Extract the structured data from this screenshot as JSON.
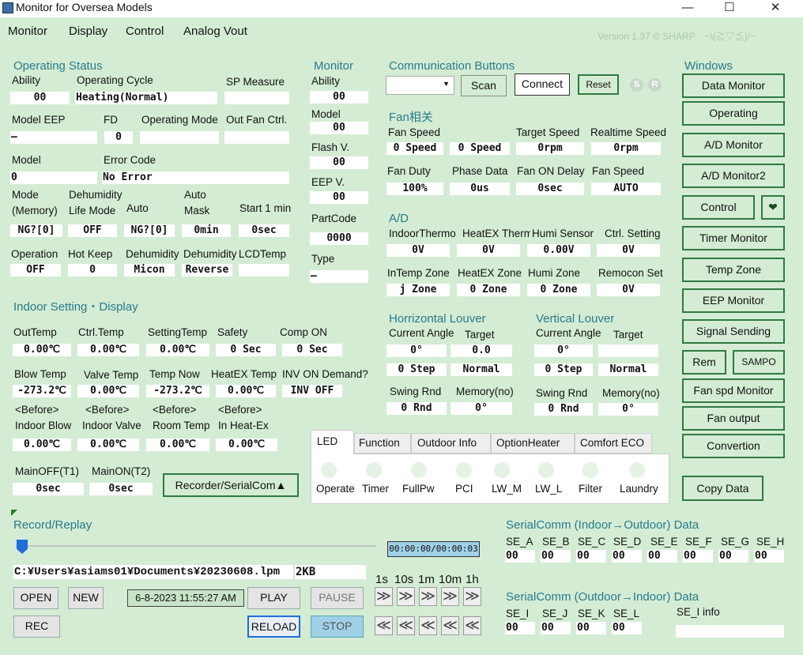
{
  "window": {
    "title": "Monitor for Oversea Models",
    "minimize": "—",
    "maximize": "☐",
    "close": "✕"
  },
  "menu": [
    "Monitor",
    "Display",
    "Control",
    "Analog Vout"
  ],
  "version": "Version 1.37 © SHARP　~\\(≧▽≦)/~",
  "op_status": {
    "title": "Operating Status",
    "ability_label": "Ability",
    "ability": "00",
    "cycle_label": "Operating Cycle",
    "cycle": "Heating(Normal)",
    "sp_label": "SP Measure",
    "sp": "",
    "eep_label": "Model EEP",
    "eep": "–",
    "fd_label": "FD",
    "fd": "0",
    "opmode_label": "Operating Mode",
    "opmode": "",
    "outfan_label": "Out Fan Ctrl.",
    "outfan": "",
    "model_label": "Model",
    "model": "0",
    "error_label": "Error Code",
    "error": "No Error",
    "mode_label1": "Mode",
    "mode_label2": "(Memory)",
    "mode": "NG?[0]",
    "dehum_label1": "Dehumidity",
    "dehum_label2": "Life Mode",
    "dehum": "OFF",
    "auto_label": "Auto",
    "auto": "NG?[0]",
    "automask_label1": "Auto",
    "automask_label2": "Mask",
    "automask": "0min",
    "start1_label": "Start 1 min",
    "start1": "0sec",
    "operation_label": "Operation",
    "operation": "OFF",
    "hotkeep_label": "Hot Keep",
    "hotkeep": "0",
    "dehum2_label": "Dehumidity",
    "dehum2": "Micon",
    "dehum3_label": "Dehumidity",
    "dehum3": "Reverse",
    "lcd_label": "LCDTemp",
    "lcd": ""
  },
  "monitor": {
    "title": "Monitor",
    "ability_label": "Ability",
    "ability": "00",
    "model_label": "Model",
    "model": "00",
    "flash_label": "Flash V.",
    "flash": "00",
    "eep_label": "EEP V.",
    "eep": "00",
    "partcode_label": "PartCode",
    "partcode": "0000",
    "type_label": "Type",
    "type": "–"
  },
  "comm": {
    "title": "Communication Buttons",
    "scan": "Scan",
    "connect": "Connect",
    "reset": "Reset",
    "s": "S",
    "r": "R"
  },
  "fan": {
    "title": "Fan相关",
    "speed_label": "Fan Speed",
    "speed1": "0 Speed",
    "speed2": "0 Speed",
    "target_label": "Target Speed",
    "target": "0rpm",
    "realtime_label": "Realtime Speed",
    "realtime": "0rpm",
    "duty_label": "Fan Duty",
    "duty": "100%",
    "phase_label": "Phase Data",
    "phase": "0us",
    "ondelay_label": "Fan ON Delay",
    "ondelay": "0sec",
    "fanspeed2_label": "Fan Speed",
    "fanspeed2": "AUTO"
  },
  "ad": {
    "title": "A/D",
    "indoor_label": "IndoorThermo",
    "indoor": "0V",
    "heatex_label": "HeatEX Thermo",
    "heatex": "0V",
    "humi_label": "Humi Sensor",
    "humi": "0.00V",
    "ctrl_label": "Ctrl. Setting",
    "ctrl": "0V",
    "intemp_label": "InTemp Zone",
    "intemp": "j Zone",
    "hexzone_label": "HeatEX Zone",
    "hexzone": "0 Zone",
    "humizone_label": "Humi Zone",
    "humizone": "0 Zone",
    "remocon_label": "Remocon Set",
    "remocon": "0V"
  },
  "hlouver": {
    "title": "Horrizontal Louver",
    "angle_label": "Current Angle",
    "angle": "0°",
    "target_label": "Target",
    "target": "0.0",
    "step": "0 Step",
    "mode": "Normal",
    "swing_label": "Swing Rnd",
    "swing": "0 Rnd",
    "mem_label": "Memory(no)",
    "mem": "0°"
  },
  "vlouver": {
    "title": "Vertical Louver",
    "angle_label": "Current Angle",
    "angle": "0°",
    "target_label": "Target",
    "target": "",
    "step": "0 Step",
    "mode": "Normal",
    "swing_label": "Swing Rnd",
    "swing": "0 Rnd",
    "mem_label": "Memory(no)",
    "mem": "0°"
  },
  "windows": {
    "title": "Windows",
    "buttons": [
      "Data Monitor",
      "Operating",
      "A/D Monitor",
      "A/D Monitor2",
      "Control",
      "Timer Monitor",
      "Temp Zone",
      "EEP Monitor",
      "Signal Sending",
      "Rem",
      "SAMPO",
      "Fan spd Monitor",
      "Fan output",
      "Convertion",
      "Copy Data"
    ],
    "heart": "❤"
  },
  "indoor": {
    "title": "Indoor Setting・Display",
    "outtemp_label": "OutTemp",
    "outtemp": "0.00℃",
    "ctrltemp_label": "Ctrl.Temp",
    "ctrltemp": "0.00℃",
    "settemp_label": "SettingTemp",
    "settemp": "0.00℃",
    "safety_label": "Safety",
    "safety": "0 Sec",
    "compon_label": "Comp ON",
    "compon": "0 Sec",
    "blow_label": "Blow Temp",
    "blow": "-273.2℃",
    "valve_label": "Valve Temp",
    "valve": "0.00℃",
    "tempnow_label": "Temp Now",
    "tempnow": "-273.2℃",
    "hextemp_label": "HeatEX Temp",
    "hextemp": "0.00℃",
    "invon_label": "INV ON Demand?",
    "invon": "INV OFF",
    "before": "<Before>",
    "bblow_label": "Indoor Blow",
    "bblow": "0.00℃",
    "bvalve_label": "Indoor Valve",
    "bvalve": "0.00℃",
    "broom_label": "Room Temp",
    "broom": "0.00℃",
    "bhex_label": "In Heat-Ex",
    "bhex": "0.00℃",
    "mainoff_label": "MainOFF(T1)",
    "mainoff": "0sec",
    "mainon_label": "MainON(T2)",
    "mainon": "0sec",
    "recorder_btn": "Recorder/SerialCom▲"
  },
  "tabs": [
    "LED",
    "Function",
    "Outdoor Info",
    "OptionHeater",
    "Comfort ECO"
  ],
  "leds": [
    "Operate",
    "Timer",
    "FullPw",
    "PCI",
    "LW_M",
    "LW_L",
    "Filter",
    "Laundry"
  ],
  "record": {
    "title": "Record/Replay",
    "time": "00:00:00/00:00:03",
    "path": "C:¥Users¥asiams01¥Documents¥20230608.lpm",
    "size": "2KB",
    "open": "OPEN",
    "new": "NEW",
    "date": "6-8-2023 11:55:27 AM",
    "play": "PLAY",
    "pause": "PAUSE",
    "rec": "REC",
    "reload": "RELOAD",
    "stop": "STOP",
    "steps": [
      "1s",
      "10s",
      "1m",
      "10m",
      "1h"
    ],
    "fwd": "≫",
    "back": "≪"
  },
  "serial_io": {
    "title": "SerialComm (Indoor→Outdoor) Data",
    "labels": [
      "SE_A",
      "SE_B",
      "SE_C",
      "SE_D",
      "SE_E",
      "SE_F",
      "SE_G",
      "SE_H"
    ],
    "values": [
      "00",
      "00",
      "00",
      "00",
      "00",
      "00",
      "00",
      "00"
    ]
  },
  "serial_oi": {
    "title": "SerialComm (Outdoor→Indoor) Data",
    "labels": [
      "SE_I",
      "SE_J",
      "SE_K",
      "SE_L"
    ],
    "values": [
      "00",
      "00",
      "00",
      "00"
    ],
    "info_label": "SE_I info",
    "info": ""
  }
}
